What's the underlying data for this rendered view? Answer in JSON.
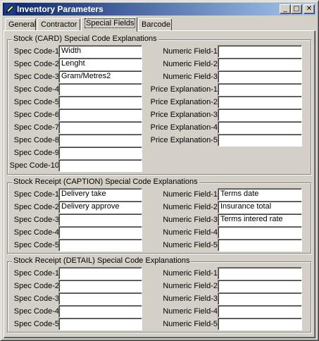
{
  "window": {
    "title": "Inventory Parameters",
    "icon": "pencil-icon"
  },
  "titlebar_buttons": {
    "minimize": "_",
    "maximize": "□",
    "close": "✕"
  },
  "tabs": [
    {
      "label": "General",
      "active": false
    },
    {
      "label": "Contractor",
      "active": false
    },
    {
      "label": "Special Fields",
      "active": true
    },
    {
      "label": "Barcode",
      "active": false
    }
  ],
  "groups": {
    "card": {
      "title": "Stock (CARD)  Special Code Explanations",
      "spec_codes": [
        {
          "label": "Spec Code-1",
          "value": "Width"
        },
        {
          "label": "Spec Code-2",
          "value": "Lenght"
        },
        {
          "label": "Spec Code-3",
          "value": "Gram/Metres2"
        },
        {
          "label": "Spec Code-4",
          "value": ""
        },
        {
          "label": "Spec Code-5",
          "value": ""
        },
        {
          "label": "Spec Code-6",
          "value": ""
        },
        {
          "label": "Spec Code-7",
          "value": ""
        },
        {
          "label": "Spec Code-8",
          "value": ""
        },
        {
          "label": "Spec Code-9",
          "value": ""
        },
        {
          "label": "Spec Code-10",
          "value": ""
        }
      ],
      "right_fields": [
        {
          "label": "Numeric Field-1",
          "value": ""
        },
        {
          "label": "Numeric Field-2",
          "value": ""
        },
        {
          "label": "Numeric Field-3",
          "value": ""
        },
        {
          "label": "Price Explanation-1",
          "value": ""
        },
        {
          "label": "Price Explanation-2",
          "value": ""
        },
        {
          "label": "Price Explanation-3",
          "value": ""
        },
        {
          "label": "Price Explanation-4",
          "value": ""
        },
        {
          "label": "Price Explanation-5",
          "value": ""
        }
      ]
    },
    "caption": {
      "title": "Stock Receipt  (CAPTION)  Special Code Explanations",
      "spec_codes": [
        {
          "label": "Spec Code-1",
          "value": "Delivery take"
        },
        {
          "label": "Spec Code-2",
          "value": "Delivery approve"
        },
        {
          "label": "Spec Code-3",
          "value": ""
        },
        {
          "label": "Spec Code-4",
          "value": ""
        },
        {
          "label": "Spec Code-5",
          "value": ""
        }
      ],
      "right_fields": [
        {
          "label": "Numeric Field-1",
          "value": "Terms date"
        },
        {
          "label": "Numeric Field-2",
          "value": "Insurance total"
        },
        {
          "label": "Numeric Field-3",
          "value": "Terms intered rate"
        },
        {
          "label": "Numeric Field-4",
          "value": ""
        },
        {
          "label": "Numeric Field-5",
          "value": ""
        }
      ]
    },
    "detail": {
      "title": "Stock Receipt  (DETAIL)  Special Code Explanations",
      "spec_codes": [
        {
          "label": "Spec Code-1",
          "value": ""
        },
        {
          "label": "Spec Code-2",
          "value": ""
        },
        {
          "label": "Spec Code-3",
          "value": ""
        },
        {
          "label": "Spec Code-4",
          "value": ""
        },
        {
          "label": "Spec Code-5",
          "value": ""
        }
      ],
      "right_fields": [
        {
          "label": "Numeric Field-1",
          "value": ""
        },
        {
          "label": "Numeric Field-2",
          "value": ""
        },
        {
          "label": "Numeric Field-3",
          "value": ""
        },
        {
          "label": "Numeric Field-4",
          "value": ""
        },
        {
          "label": "Numeric Field-5",
          "value": ""
        }
      ]
    }
  }
}
